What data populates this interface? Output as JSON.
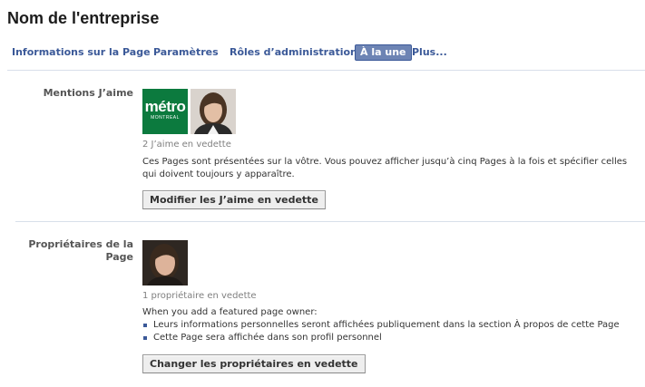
{
  "page": {
    "title": "Nom de l'entreprise"
  },
  "tabs": [
    {
      "label": "Informations sur la Page"
    },
    {
      "label": "Paramètres"
    },
    {
      "label": "Rôles d’administration"
    },
    {
      "label": "À la une",
      "active": true
    },
    {
      "label": "Plus..."
    }
  ],
  "likes_section": {
    "label": "Mentions J’aime",
    "logo_text": "métro",
    "logo_subtext": "MONTREAL",
    "count_text": "2 J’aime en vedette",
    "description": "Ces Pages sont présentées sur la vôtre. Vous pouvez afficher jusqu’à cinq Pages à la fois et spécifier celles qui doivent toujours y apparaître.",
    "button_label": "Modifier les J’aime en vedette"
  },
  "owners_section": {
    "label": "Propriétaires de la Page",
    "count_text": "1 propriétaire en vedette",
    "intro": "When you add a featured page owner:",
    "bullets": [
      "Leurs informations personnelles seront affichées publiquement dans la section À propos de cette Page",
      "Cette Page sera affichée dans son profil personnel"
    ],
    "button_label": "Changer les propriétaires en vedette"
  },
  "colors": {
    "link": "#3b5998",
    "active_tab_bg": "#6d84b4",
    "metro_green": "#0c7a3e"
  }
}
